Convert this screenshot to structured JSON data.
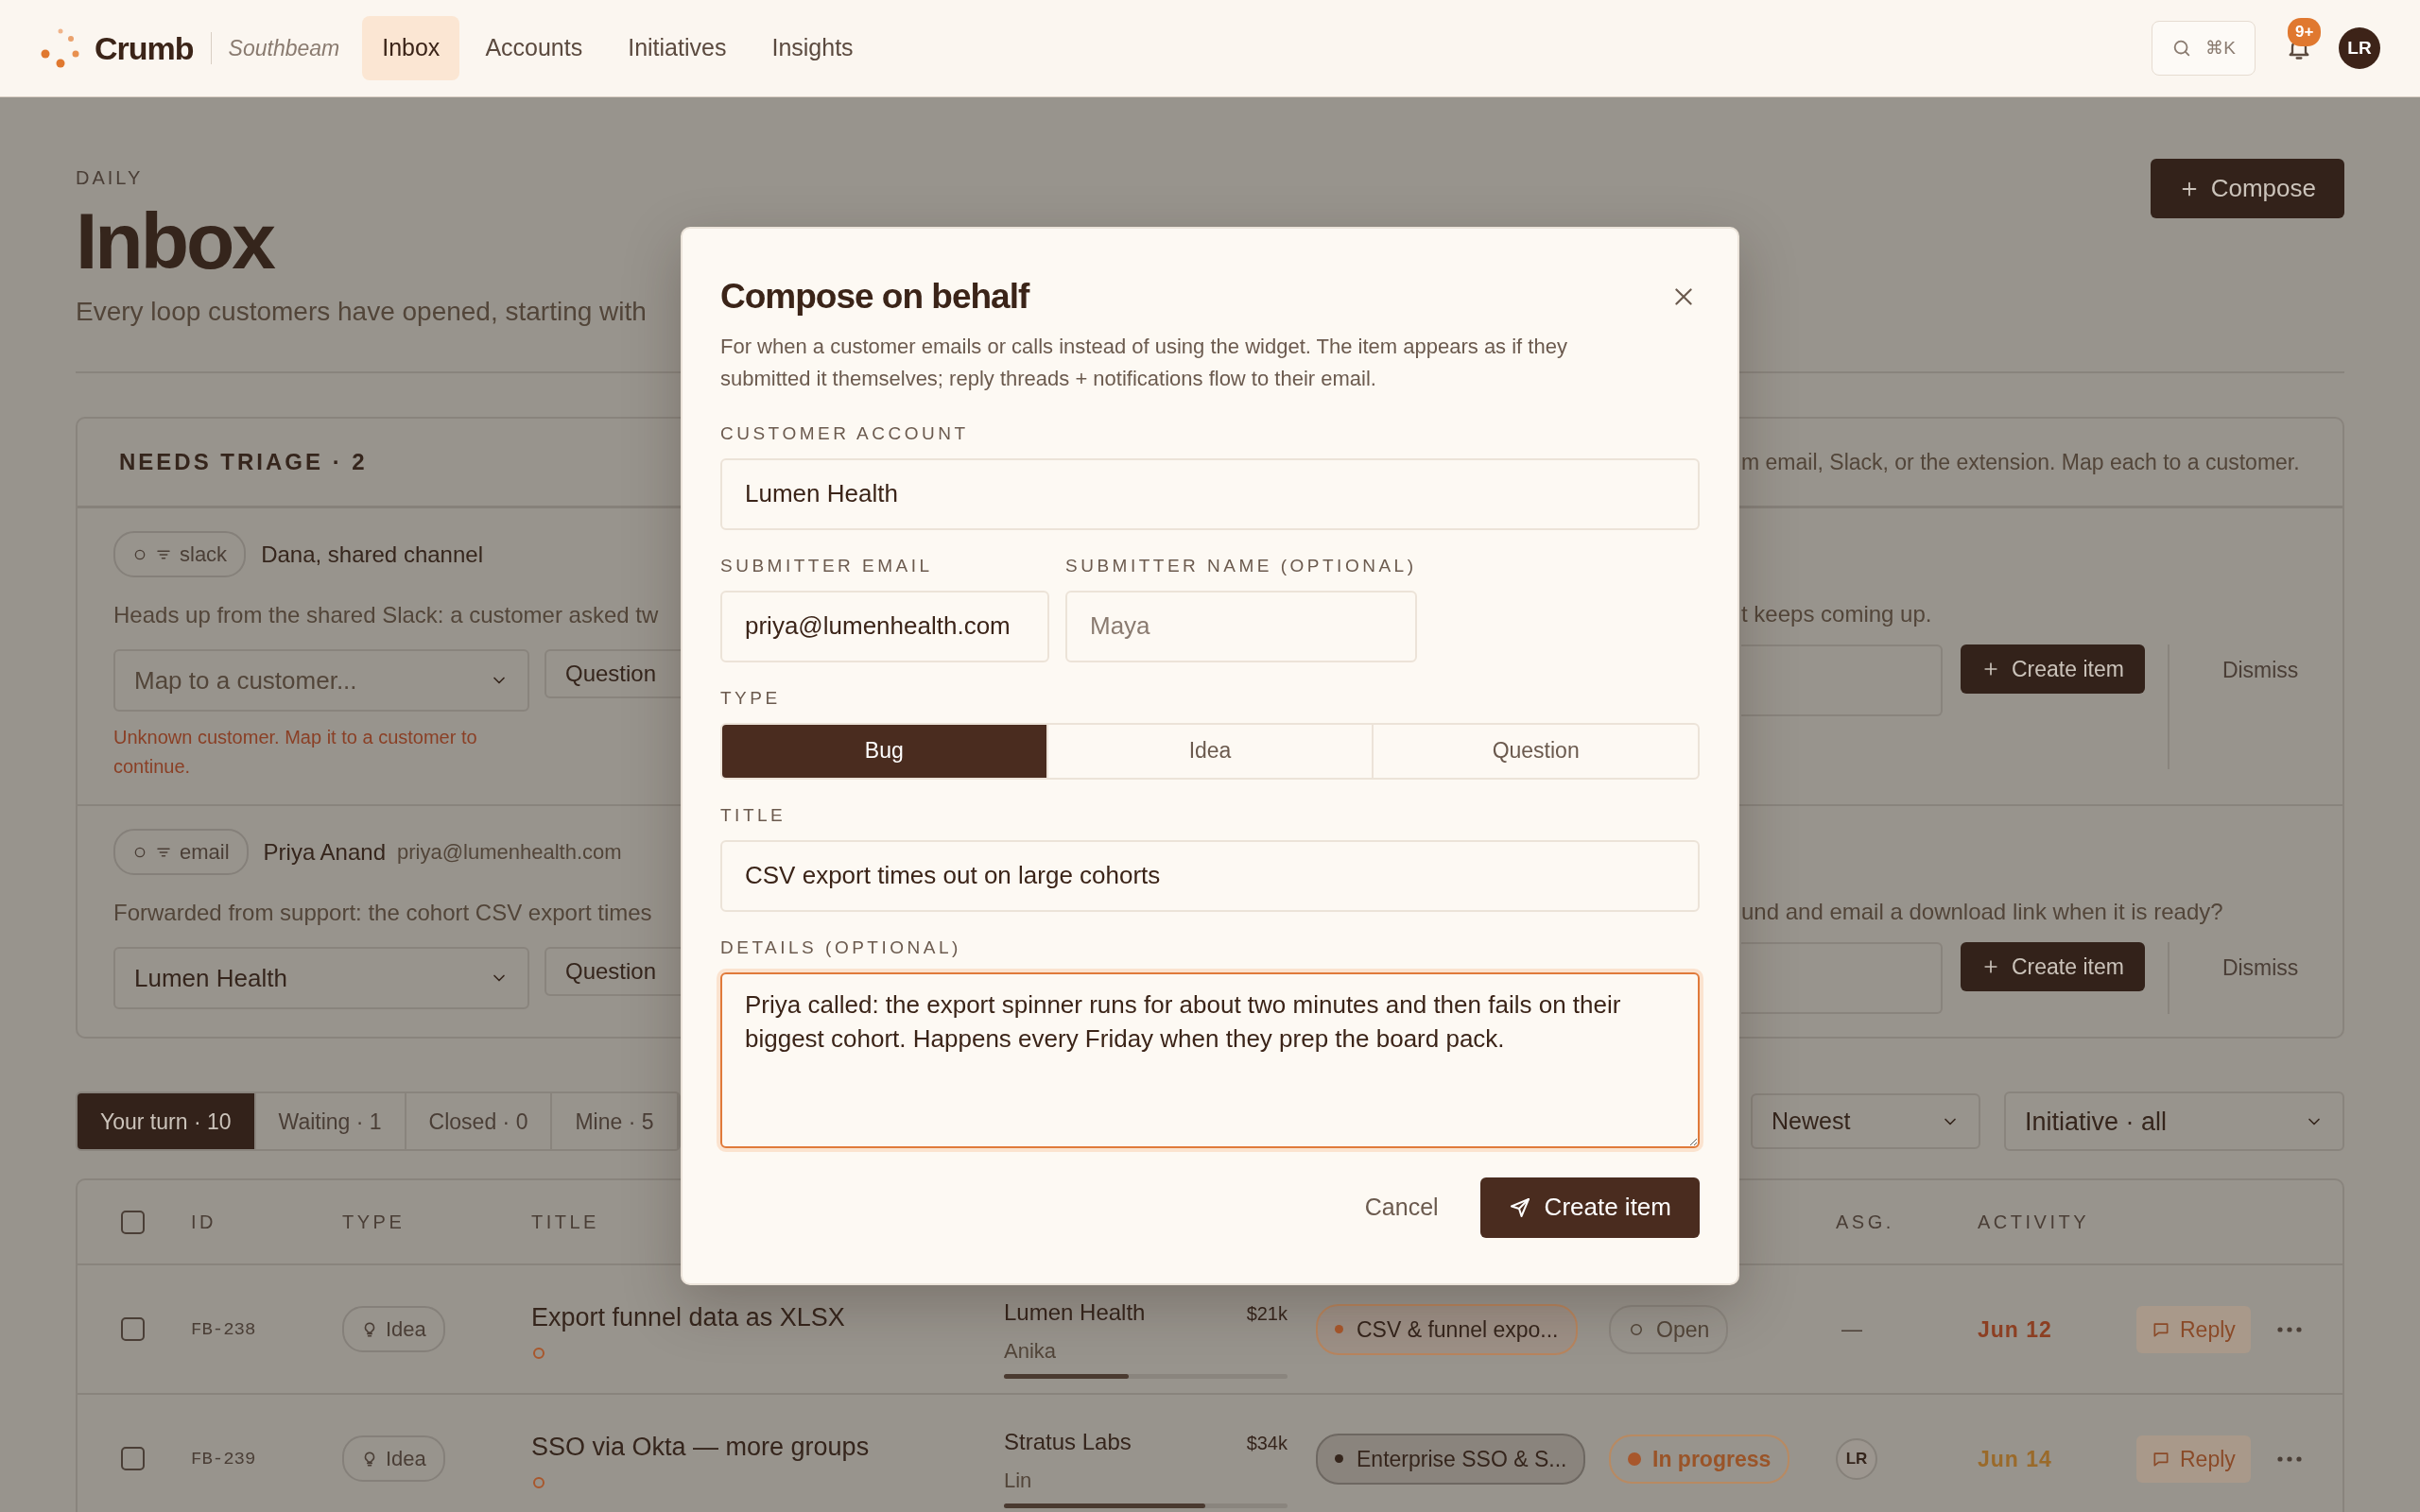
{
  "nav": {
    "brand": "Crumb",
    "workspace": "Southbeam",
    "items": [
      {
        "label": "Inbox",
        "selected": true
      },
      {
        "label": "Accounts",
        "selected": false
      },
      {
        "label": "Initiatives",
        "selected": false
      },
      {
        "label": "Insights",
        "selected": false
      }
    ],
    "search_shortcut": "⌘K",
    "notification_badge": "9+",
    "avatar": "LR"
  },
  "page": {
    "eyebrow": "DAILY",
    "title": "Inbox",
    "subtitle": "Every loop customers have opened, starting with",
    "compose_button": "Compose"
  },
  "triage": {
    "title": "NEEDS TRIAGE · 2",
    "note": "m email, Slack, or the extension. Map each to a customer.",
    "items": [
      {
        "source": "slack",
        "sender": "Dana, shared channel",
        "message_start": "Heads up from the shared Slack: a customer asked tw",
        "message_end": "t keeps coming up.",
        "customer_placeholder": "Map to a customer...",
        "type": "Question",
        "error": "Unknown customer. Map it to a customer to continue.",
        "create_button": "Create item",
        "dismiss_button": "Dismiss"
      },
      {
        "source": "email",
        "sender": "Priya Anand",
        "email": "priya@lumenhealth.com",
        "message_start": "Forwarded from support: the cohort CSV export times",
        "message_end": "und and email a download link when it is ready?",
        "customer": "Lumen Health",
        "type": "Question",
        "create_button": "Create item",
        "dismiss_button": "Dismiss"
      }
    ]
  },
  "tabs": [
    {
      "label": "Your turn · 10",
      "selected": true
    },
    {
      "label": "Waiting · 1",
      "selected": false
    },
    {
      "label": "Closed · 0",
      "selected": false
    },
    {
      "label": "Mine · 5",
      "selected": false
    }
  ],
  "sort": "Newest",
  "initiative_filter": "Initiative · all",
  "table": {
    "header_checked": false,
    "columns": {
      "id": "ID",
      "type": "TYPE",
      "title": "TITLE",
      "assignee": "ASG.",
      "activity": "ACTIVITY"
    },
    "rows": [
      {
        "checked": false,
        "id": "FB-238",
        "type": "Idea",
        "title": "Export funnel data as XLSX",
        "customer": "Lumen Health",
        "value": "$21k",
        "owner": "Anika",
        "level": 0.44,
        "initiative": "CSV & funnel expo...",
        "color": "#a8572c",
        "status": {
          "kind": "open",
          "label": "Open"
        },
        "assignee": {
          "kind": "none",
          "text": "—"
        },
        "activity": {
          "text": "Jun 12",
          "color": "#8c3f22"
        },
        "reply": "Reply"
      },
      {
        "checked": false,
        "id": "FB-239",
        "type": "Idea",
        "title": "SSO via Okta — more groups",
        "customer": "Stratus Labs",
        "value": "$34k",
        "owner": "Lin",
        "level": 0.71,
        "initiative": "Enterprise SSO & S...",
        "color": "#35251c",
        "status": {
          "kind": "in_progress",
          "label": "In progress"
        },
        "assignee": {
          "kind": "avatar",
          "text": "LR"
        },
        "activity": {
          "text": "Jun 14",
          "color": "#9a6a2a"
        },
        "reply": "Reply"
      }
    ]
  },
  "modal": {
    "title": "Compose on behalf",
    "description": "For when a customer emails or calls instead of using the widget. The item appears as if they submitted it themselves; reply threads + notifications flow to their email.",
    "customer_label": "CUSTOMER ACCOUNT",
    "customer_value": "Lumen Health",
    "email_label": "SUBMITTER EMAIL",
    "email_value": "priya@lumenhealth.com",
    "name_label": "SUBMITTER NAME (OPTIONAL)",
    "name_placeholder": "Maya",
    "type_label": "TYPE",
    "types": [
      {
        "label": "Bug",
        "selected": true
      },
      {
        "label": "Idea",
        "selected": false
      },
      {
        "label": "Question",
        "selected": false
      }
    ],
    "title_label": "TITLE",
    "title_value": "CSV export times out on large cohorts",
    "details_label": "DETAILS (OPTIONAL)",
    "details_value": "Priya called: the export spinner runs for about two minutes and then fails on their biggest cohort. Happens every Friday when they prep the board pack.",
    "details_focused": true,
    "cancel": "Cancel",
    "submit": "Create item"
  }
}
